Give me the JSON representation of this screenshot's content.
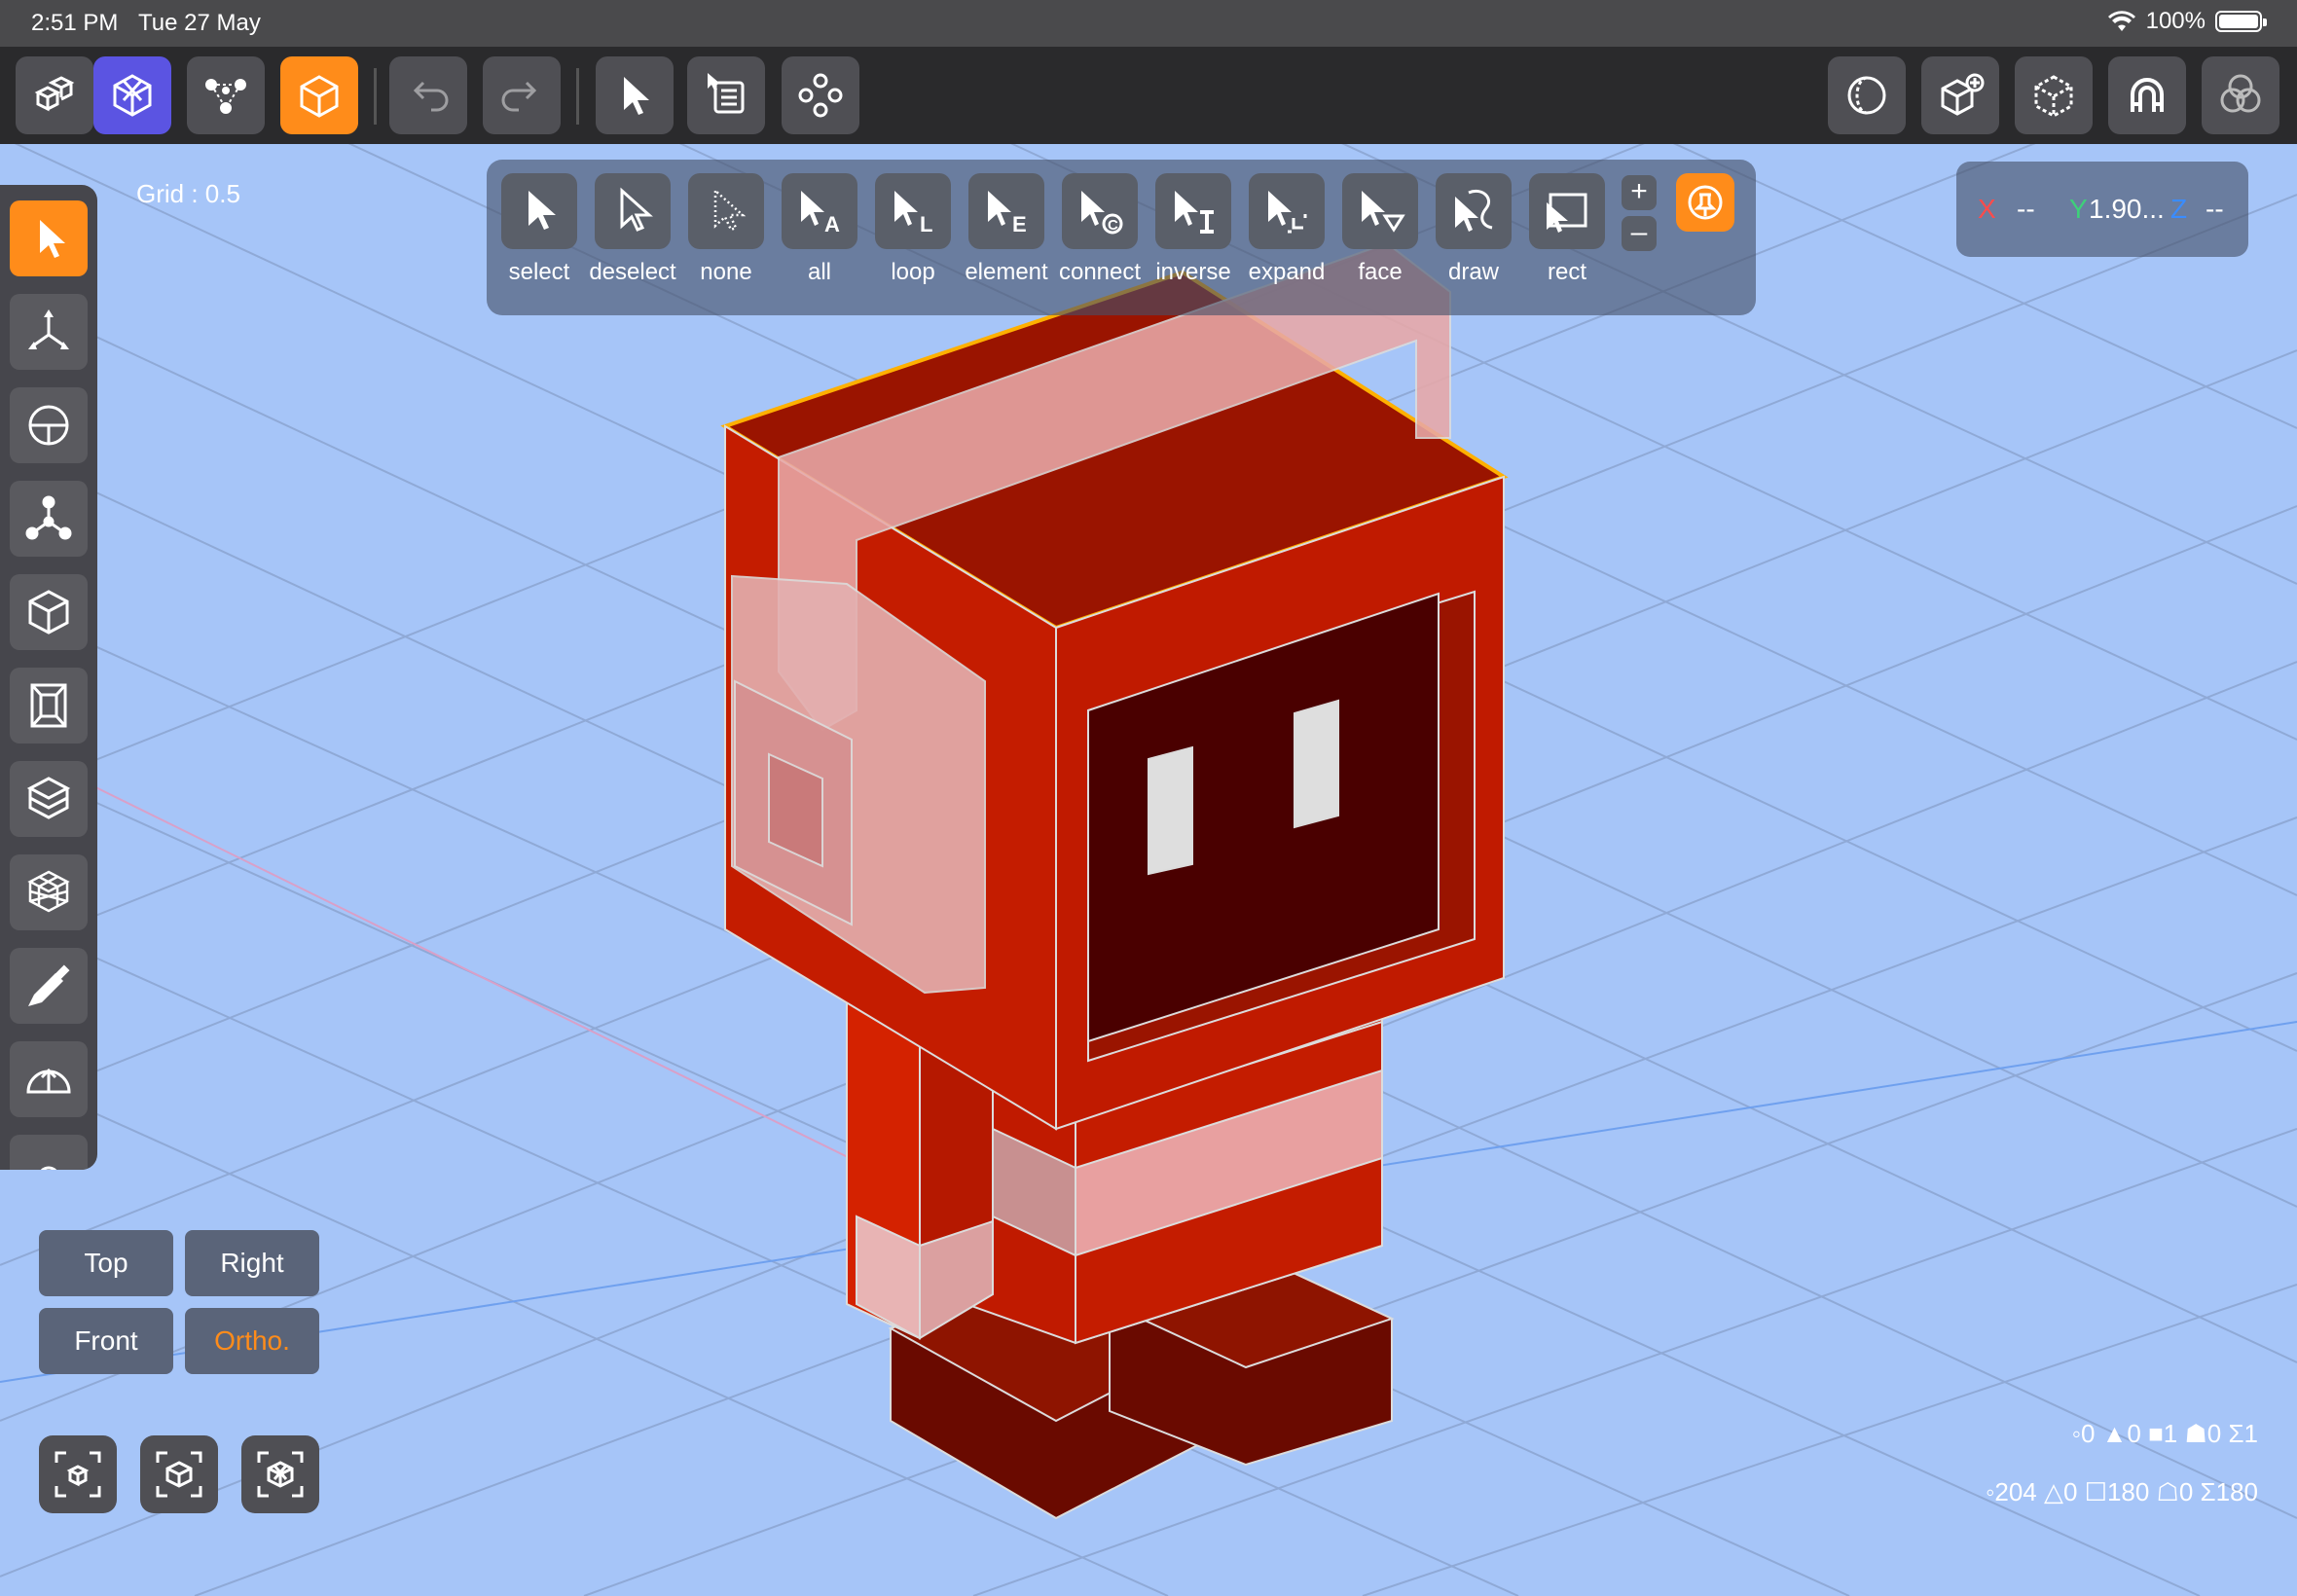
{
  "status_bar": {
    "time": "2:51 PM",
    "date": "Tue 27 May",
    "battery": "100%"
  },
  "viewport": {
    "grid_label": "Grid : 0.5",
    "background_color": "#a6c5f8",
    "model": "red boxy robot character with headphones"
  },
  "selection_panel": {
    "items": [
      {
        "label": "select",
        "icon": "cursor-filled-icon"
      },
      {
        "label": "deselect",
        "icon": "cursor-outline-icon"
      },
      {
        "label": "none",
        "icon": "cursor-dotted-icon"
      },
      {
        "label": "all",
        "icon": "cursor-a-icon"
      },
      {
        "label": "loop",
        "icon": "cursor-l-icon"
      },
      {
        "label": "element",
        "icon": "cursor-e-icon"
      },
      {
        "label": "connect",
        "icon": "cursor-c-icon"
      },
      {
        "label": "inverse",
        "icon": "cursor-i-icon"
      },
      {
        "label": "expand",
        "icon": "cursor-expand-icon"
      },
      {
        "label": "face",
        "icon": "cursor-face-icon"
      },
      {
        "label": "draw",
        "icon": "cursor-draw-icon"
      },
      {
        "label": "rect",
        "icon": "cursor-rect-icon"
      }
    ],
    "plus": "+",
    "minus": "–"
  },
  "coordinates": {
    "x_label": "X",
    "x_value": "--",
    "y_label": "Y",
    "y_value": "1.90...",
    "z_label": "Z",
    "z_value": "--"
  },
  "view_buttons": {
    "top": "Top",
    "right": "Right",
    "front": "Front",
    "ortho": "Ortho."
  },
  "stats": {
    "selected": "◦0 ▲0 ■1 ☗0 Σ1",
    "total": "◦204 △0 ☐180 ☖0 Σ180"
  },
  "colors": {
    "accent": "#ff8c1a",
    "purple": "#5b54e2",
    "x_axis": "#ff4b4b",
    "y_axis": "#3ed07a",
    "z_axis": "#3a8cff"
  }
}
